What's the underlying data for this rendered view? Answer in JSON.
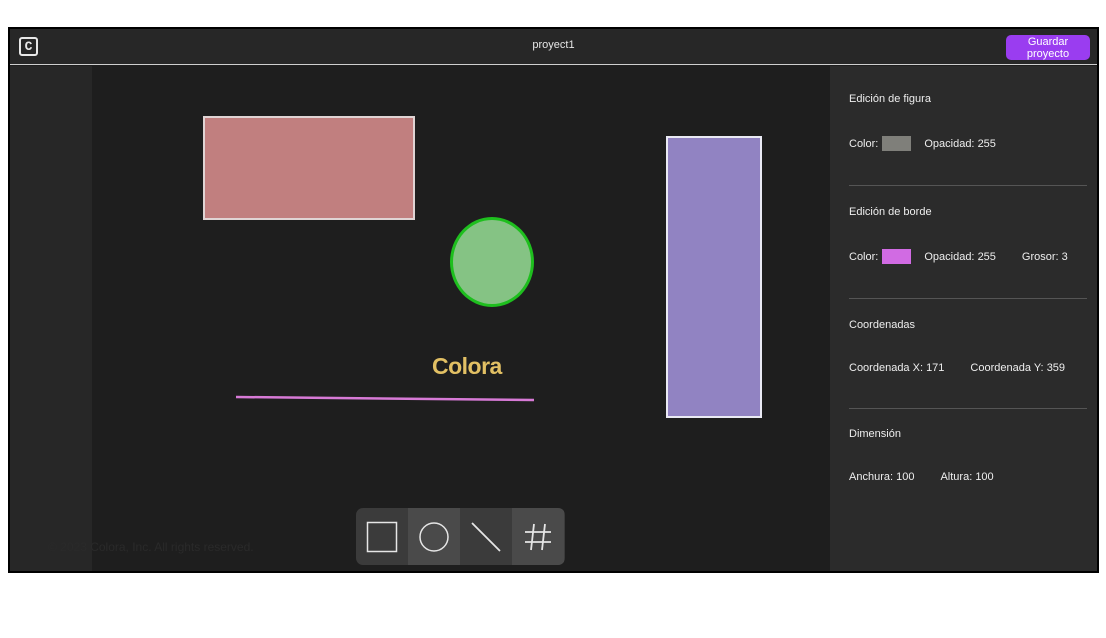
{
  "header": {
    "logo_letter": "C",
    "project_name": "proyect1",
    "save_label": "Guardar proyecto"
  },
  "canvas": {
    "shapes": [
      {
        "type": "rectangle",
        "fill": "#c17f7f",
        "stroke": "#e0d4d4"
      },
      {
        "type": "ellipse",
        "fill": "#85c384",
        "stroke": "#1ebf1e"
      },
      {
        "type": "rectangle",
        "fill": "#9183c2",
        "stroke": "#eaeaf4"
      },
      {
        "type": "line",
        "stroke": "#d77ad6"
      }
    ],
    "text_shape": "Colora",
    "text_color": "#e2c064",
    "footer": "© 2023 Colora, Inc. All rights reserved."
  },
  "toolbar": {
    "tools": [
      {
        "name": "rectangle-tool",
        "icon": "square-icon"
      },
      {
        "name": "circle-tool",
        "icon": "circle-icon"
      },
      {
        "name": "line-tool",
        "icon": "line-icon"
      },
      {
        "name": "text-tool",
        "icon": "hash-icon"
      }
    ]
  },
  "panel": {
    "figure": {
      "title": "Edición de figura",
      "color_label": "Color:",
      "color_value": "#7f7f7a",
      "opacity_label": "Opacidad:",
      "opacity_value": "255"
    },
    "border": {
      "title": "Edición de borde",
      "color_label": "Color:",
      "color_value": "#d16be3",
      "opacity_label": "Opacidad:",
      "opacity_value": "255",
      "thickness_label": "Grosor:",
      "thickness_value": "3"
    },
    "coords": {
      "title": "Coordenadas",
      "x_label": "Coordenada X:",
      "x_value": "171",
      "y_label": "Coordenada Y:",
      "y_value": "359"
    },
    "dimension": {
      "title": "Dimensión",
      "width_label": "Anchura:",
      "width_value": "100",
      "height_label": "Altura:",
      "height_value": "100"
    }
  }
}
